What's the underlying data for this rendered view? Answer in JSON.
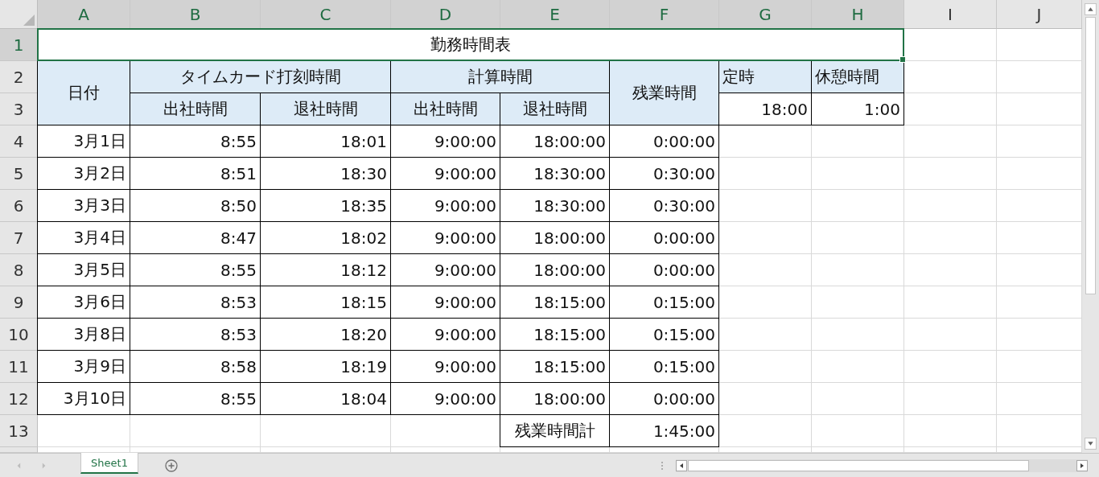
{
  "columns": [
    {
      "label": "A",
      "selected": true
    },
    {
      "label": "B",
      "selected": true
    },
    {
      "label": "C",
      "selected": true
    },
    {
      "label": "D",
      "selected": true
    },
    {
      "label": "E",
      "selected": true
    },
    {
      "label": "F",
      "selected": true
    },
    {
      "label": "G",
      "selected": true
    },
    {
      "label": "H",
      "selected": true
    },
    {
      "label": "I",
      "selected": false
    },
    {
      "label": "J",
      "selected": false
    }
  ],
  "rows": [
    {
      "label": "1",
      "selected": true
    },
    {
      "label": "2",
      "selected": false
    },
    {
      "label": "3",
      "selected": false
    },
    {
      "label": "4",
      "selected": false
    },
    {
      "label": "5",
      "selected": false
    },
    {
      "label": "6",
      "selected": false
    },
    {
      "label": "7",
      "selected": false
    },
    {
      "label": "8",
      "selected": false
    },
    {
      "label": "9",
      "selected": false
    },
    {
      "label": "10",
      "selected": false
    },
    {
      "label": "11",
      "selected": false
    },
    {
      "label": "12",
      "selected": false
    },
    {
      "label": "13",
      "selected": false
    }
  ],
  "title": {
    "text": "勤務時間表",
    "selected": true
  },
  "header": {
    "date": "日付",
    "groups": [
      {
        "label": "タイムカード打刻時間",
        "columns": [
          "出社時間",
          "退社時間"
        ]
      },
      {
        "label": "計算時間",
        "columns": [
          "出社時間",
          "退社時間"
        ]
      }
    ],
    "overtime": "残業時間"
  },
  "settings": [
    {
      "label": "定時",
      "value": "18:00"
    },
    {
      "label": "休憩時間",
      "value": "1:00"
    }
  ],
  "records": [
    {
      "date": "3月1日",
      "clock_in": "8:55",
      "clock_out": "18:01",
      "calc_in": "9:00:00",
      "calc_out": "18:00:00",
      "overtime": "0:00:00"
    },
    {
      "date": "3月2日",
      "clock_in": "8:51",
      "clock_out": "18:30",
      "calc_in": "9:00:00",
      "calc_out": "18:30:00",
      "overtime": "0:30:00"
    },
    {
      "date": "3月3日",
      "clock_in": "8:50",
      "clock_out": "18:35",
      "calc_in": "9:00:00",
      "calc_out": "18:30:00",
      "overtime": "0:30:00"
    },
    {
      "date": "3月4日",
      "clock_in": "8:47",
      "clock_out": "18:02",
      "calc_in": "9:00:00",
      "calc_out": "18:00:00",
      "overtime": "0:00:00"
    },
    {
      "date": "3月5日",
      "clock_in": "8:55",
      "clock_out": "18:12",
      "calc_in": "9:00:00",
      "calc_out": "18:00:00",
      "overtime": "0:00:00"
    },
    {
      "date": "3月6日",
      "clock_in": "8:53",
      "clock_out": "18:15",
      "calc_in": "9:00:00",
      "calc_out": "18:15:00",
      "overtime": "0:15:00"
    },
    {
      "date": "3月8日",
      "clock_in": "8:53",
      "clock_out": "18:20",
      "calc_in": "9:00:00",
      "calc_out": "18:15:00",
      "overtime": "0:15:00"
    },
    {
      "date": "3月9日",
      "clock_in": "8:58",
      "clock_out": "18:19",
      "calc_in": "9:00:00",
      "calc_out": "18:15:00",
      "overtime": "0:15:00"
    },
    {
      "date": "3月10日",
      "clock_in": "8:55",
      "clock_out": "18:04",
      "calc_in": "9:00:00",
      "calc_out": "18:00:00",
      "overtime": "0:00:00"
    }
  ],
  "total": {
    "label": "残業時間計",
    "value": "1:45:00"
  },
  "sheet_tabs": [
    {
      "label": "Sheet1",
      "selected": true
    }
  ]
}
